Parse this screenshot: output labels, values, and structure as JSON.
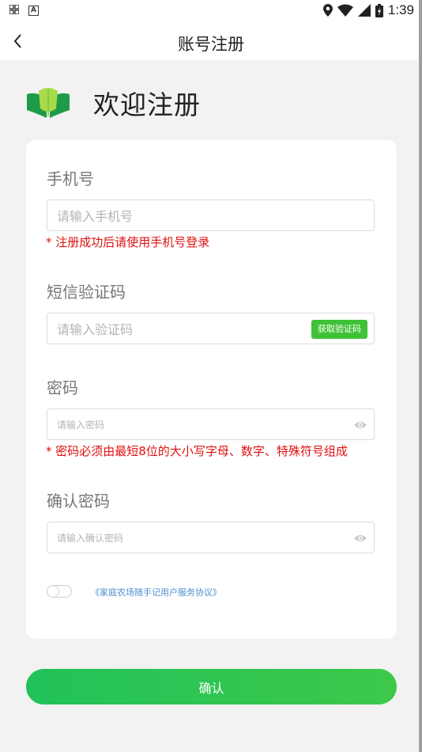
{
  "status_bar": {
    "time": "1:39"
  },
  "header": {
    "title": "账号注册"
  },
  "welcome": {
    "text": "欢迎注册"
  },
  "form": {
    "phone": {
      "label": "手机号",
      "placeholder": "请输入手机号",
      "hint": "* 注册成功后请使用手机号登录"
    },
    "sms": {
      "label": "短信验证码",
      "placeholder": "请输入验证码",
      "button": "获取验证码"
    },
    "password": {
      "label": "密码",
      "placeholder": "请输入密码",
      "hint": "* 密码必须由最短8位的大小写字母、数字、特殊符号组成"
    },
    "confirm_password": {
      "label": "确认密码",
      "placeholder": "请输入确认密码"
    },
    "agreement": {
      "text": "《家庭农场随手记用户服务协议》",
      "checked": false
    }
  },
  "actions": {
    "confirm_label": "确认"
  },
  "colors": {
    "accent": "#3fc236",
    "hint": "#e01010",
    "link": "#4a8fd0"
  }
}
